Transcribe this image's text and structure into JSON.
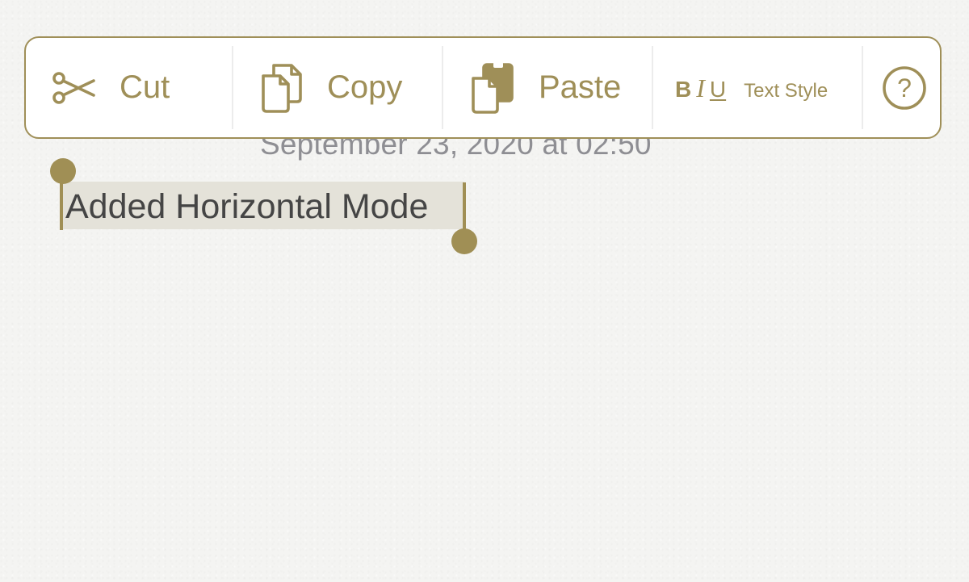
{
  "note": {
    "date": "September 23, 2020 at 02:50",
    "body": "Added Horizontal Mode"
  },
  "edit_menu": {
    "cut_label": "Cut",
    "copy_label": "Copy",
    "paste_label": "Paste",
    "biu_bold": "B",
    "biu_italic": "I",
    "biu_underline": "U",
    "text_style_label": "Text Style",
    "help_glyph": "?"
  },
  "icons": [
    "scissors-icon",
    "copy-icon",
    "paste-icon",
    "text-style-icon",
    "help-icon"
  ],
  "colors": {
    "accent": "#9f8f58",
    "selection": "#e4e2d9",
    "date_text": "#8e8e93",
    "body_text": "#454545"
  }
}
